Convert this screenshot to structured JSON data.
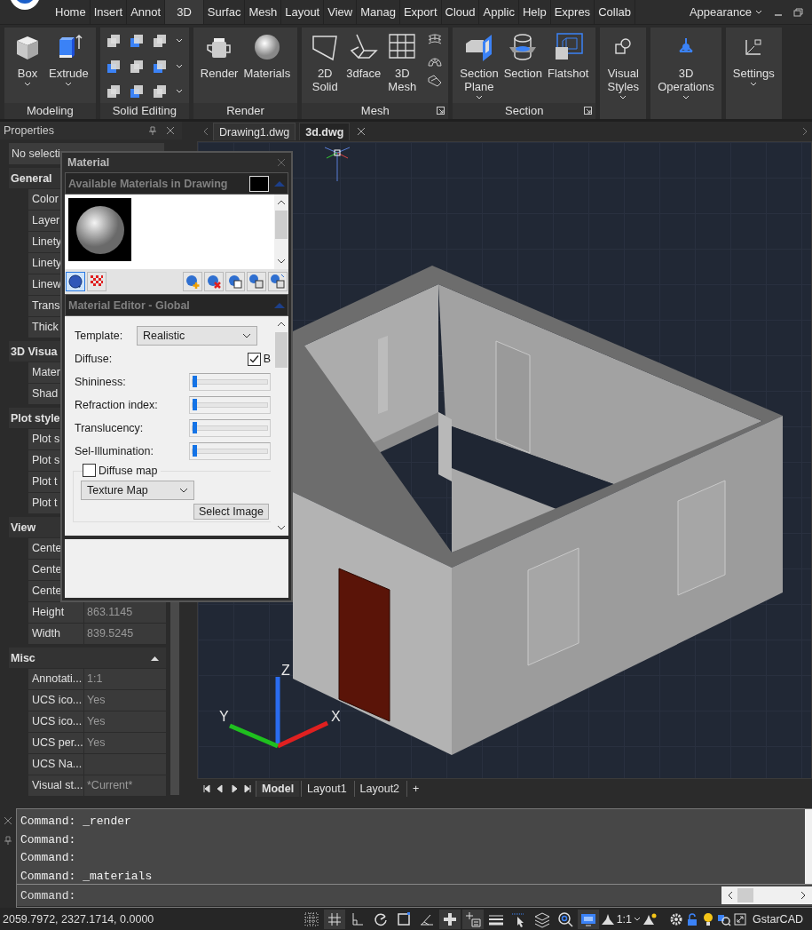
{
  "menu_tabs": [
    {
      "label": "Home",
      "selected": false
    },
    {
      "label": "Insert",
      "selected": false
    },
    {
      "label": "Annot",
      "selected": false
    },
    {
      "label": "3D",
      "selected": true
    },
    {
      "label": "Surfac",
      "selected": false
    },
    {
      "label": "Mesh",
      "selected": false
    },
    {
      "label": "Layout",
      "selected": false
    },
    {
      "label": "View",
      "selected": false
    },
    {
      "label": "Manag",
      "selected": false
    },
    {
      "label": "Export",
      "selected": false
    },
    {
      "label": "Cloud",
      "selected": false
    },
    {
      "label": "Applic",
      "selected": false
    },
    {
      "label": "Help",
      "selected": false
    },
    {
      "label": "Expres",
      "selected": false
    },
    {
      "label": "Collab",
      "selected": false
    }
  ],
  "appearance": "Appearance",
  "ribbon_panels": [
    {
      "title": "Modeling",
      "kind": "tools",
      "launcher": false,
      "tools": [
        {
          "label": "Box",
          "kind": "box",
          "dropdown": true
        },
        {
          "label": "Extrude",
          "kind": "extrude",
          "dropdown": true
        }
      ]
    },
    {
      "title": "Solid Editing",
      "kind": "icon_grid",
      "launcher": false
    },
    {
      "title": "Render",
      "kind": "tools",
      "launcher": false,
      "tools": [
        {
          "label": "Render",
          "kind": "teapot",
          "dropdown": false
        },
        {
          "label": "Materials",
          "kind": "sphere",
          "dropdown": false
        }
      ]
    },
    {
      "title": "Mesh",
      "kind": "tools_and_column",
      "launcher": true,
      "tools": [
        {
          "label": "2D Solid",
          "kind": "solid2d",
          "dropdown": false
        },
        {
          "label": "3dface",
          "kind": "face3d",
          "dropdown": false
        },
        {
          "label": "3D Mesh",
          "kind": "mesh",
          "dropdown": false
        }
      ]
    },
    {
      "title": "Section",
      "kind": "tools",
      "launcher": true,
      "tools": [
        {
          "label": "Section Plane",
          "kind": "section_plane",
          "dropdown": true
        },
        {
          "label": "Section",
          "kind": "section",
          "dropdown": false
        },
        {
          "label": "Flatshot",
          "kind": "flatshot",
          "dropdown": false
        }
      ]
    },
    {
      "kind": "tools",
      "launcher": false,
      "tools": [
        {
          "label": "Visual Styles",
          "kind": "visual_styles",
          "dropdown": true
        }
      ]
    },
    {
      "kind": "tools",
      "launcher": false,
      "tools": [
        {
          "label": "3D Operations",
          "kind": "operations",
          "dropdown": true
        }
      ]
    },
    {
      "kind": "tools",
      "launcher": false,
      "tools": [
        {
          "label": "Settings",
          "kind": "settings",
          "dropdown": true
        }
      ]
    }
  ],
  "properties": {
    "title": "Properties",
    "selection": "No selecti",
    "groups": [
      {
        "title": "General",
        "collapse_arrow": false,
        "rows": [
          {
            "label": "Color"
          },
          {
            "label": "Layer"
          },
          {
            "label": "Linety"
          },
          {
            "label": "Linety"
          },
          {
            "label": "Linew"
          },
          {
            "label": "Trans"
          },
          {
            "label": "Thick"
          }
        ]
      },
      {
        "title": "3D Visua",
        "collapse_arrow": false,
        "rows": [
          {
            "label": "Mater"
          },
          {
            "label": "Shad"
          }
        ]
      },
      {
        "title": "Plot style",
        "collapse_arrow": false,
        "rows": [
          {
            "label": "Plot s"
          },
          {
            "label": "Plot s"
          },
          {
            "label": "Plot t"
          },
          {
            "label": "Plot t"
          }
        ]
      },
      {
        "title": "View",
        "collapse_arrow": false,
        "rows": [
          {
            "label": "Cente"
          },
          {
            "label": "Cente"
          },
          {
            "label": "Cente"
          },
          {
            "label": "Height",
            "value": "863.1145"
          },
          {
            "label": "Width",
            "value": "839.5245"
          }
        ]
      },
      {
        "title": "Misc",
        "collapse_arrow": true,
        "rows": [
          {
            "label": "Annotati...",
            "value": "1:1"
          },
          {
            "label": "UCS ico...",
            "value": "Yes"
          },
          {
            "label": "UCS ico...",
            "value": "Yes"
          },
          {
            "label": "UCS per...",
            "value": "Yes"
          },
          {
            "label": "UCS Na..."
          },
          {
            "label": "Visual st...",
            "value": "*Current*"
          }
        ]
      }
    ]
  },
  "doc_tabs": [
    {
      "label": "Drawing1.dwg",
      "selected": false
    },
    {
      "label": "3d.dwg",
      "selected": true
    }
  ],
  "ucs_icon": {
    "x": "X",
    "y": "Y",
    "z": "Z"
  },
  "layout_tabs": [
    {
      "label": "Model",
      "selected": true
    },
    {
      "label": "Layout1",
      "selected": false
    },
    {
      "label": "Layout2",
      "selected": false
    }
  ],
  "add_layout": "+",
  "command_history": [
    "Command: _render",
    "Command:",
    "Command:",
    "Command: _materials"
  ],
  "command_prompt": "Command:",
  "status_bar": {
    "coordinates": "2059.7972, 2327.1714, 0.0000",
    "scale": "1:1",
    "brand": "GstarCAD",
    "toggles": [
      {
        "kind": "grid_dots",
        "on": false
      },
      {
        "kind": "snap",
        "on": true
      },
      {
        "kind": "ortho",
        "on": false
      },
      {
        "kind": "polar",
        "on": false
      },
      {
        "kind": "osnap",
        "on": false
      },
      {
        "kind": "angle",
        "on": false
      },
      {
        "kind": "plus",
        "on": true
      },
      {
        "kind": "plus_list",
        "on": true
      },
      {
        "kind": "lineweight",
        "on": false
      },
      {
        "kind": "cursor",
        "on": false
      },
      {
        "kind": "layers",
        "on": false
      },
      {
        "kind": "magnifier",
        "on": false
      },
      {
        "kind": "monitor",
        "on": true
      }
    ]
  },
  "material_dialog": {
    "title": "Material",
    "library_title": "Available Materials in Drawing",
    "view_modes": [
      {
        "kind": "sphere",
        "selected": true
      },
      {
        "kind": "checker",
        "selected": false
      }
    ],
    "editor_title": "Material Editor - Global",
    "template_label": "Template:",
    "template": "Realistic",
    "diffuse_label": "Diffuse:",
    "diffuse_check": {
      "label": "B",
      "checked": true
    },
    "sliders": [
      {
        "label": "Shininess:",
        "level": 0.0
      },
      {
        "label": "Refraction index:",
        "level": 0.0
      },
      {
        "label": "Translucency:",
        "level": 0.0
      },
      {
        "label": "Sel-Illumination:",
        "level": 0.0
      }
    ],
    "diffuse_map": {
      "label": "Diffuse map",
      "checked": false
    },
    "map_type": "Texture Map",
    "select_button": "Select Image"
  }
}
